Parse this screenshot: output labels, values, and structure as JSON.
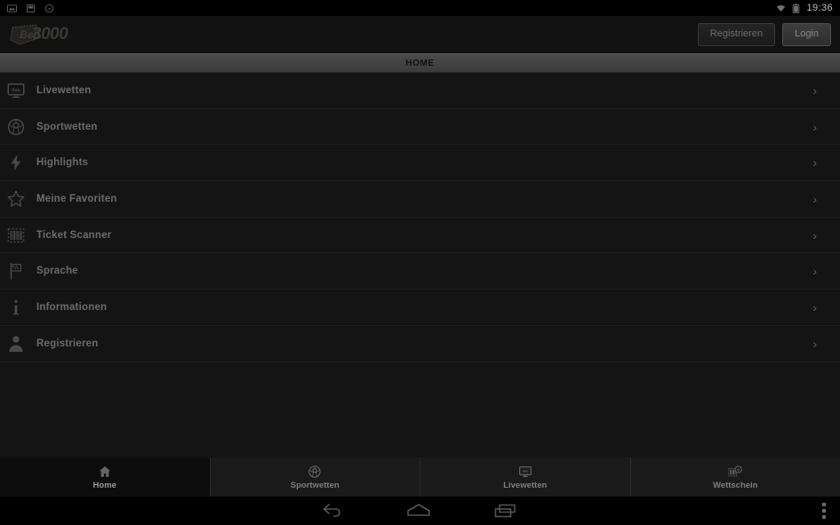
{
  "status_bar": {
    "icons": [
      "screenshot-icon",
      "sd-card-icon",
      "sync-icon"
    ],
    "wifi_icon": "wifi-icon",
    "battery_icon": "battery-icon",
    "time": "19:36"
  },
  "header": {
    "logo_text": "3000",
    "logo_brand": "Bet3000",
    "register_label": "Registrieren",
    "login_label": "Login"
  },
  "title_bar": {
    "title": "HOME"
  },
  "menu": {
    "items": [
      {
        "label": "Livewetten",
        "icon": "tv-monitor-icon",
        "chevron": "›"
      },
      {
        "label": "Sportwetten",
        "icon": "soccer-ball-icon",
        "chevron": "›"
      },
      {
        "label": "Highlights",
        "icon": "lightning-icon",
        "chevron": "›"
      },
      {
        "label": "Meine Favoriten",
        "icon": "star-icon",
        "chevron": "›"
      },
      {
        "label": "Ticket Scanner",
        "icon": "barcode-icon",
        "chevron": "›"
      },
      {
        "label": "Sprache",
        "icon": "flag-icon",
        "chevron": "›"
      },
      {
        "label": "Informationen",
        "icon": "info-icon",
        "chevron": "›"
      },
      {
        "label": "Registrieren",
        "icon": "person-icon",
        "chevron": "›"
      }
    ]
  },
  "bottom_tabs": {
    "items": [
      {
        "label": "Home",
        "icon": "home-icon",
        "active": true
      },
      {
        "label": "Sportwetten",
        "icon": "soccer-ball-icon",
        "active": false
      },
      {
        "label": "Livewetten",
        "icon": "tv-monitor-icon",
        "active": false
      },
      {
        "label": "Wettschein",
        "icon": "bet-slip-icon",
        "active": false
      }
    ]
  },
  "nav_bar": {
    "back_icon": "back-arrow-icon",
    "home_icon": "home-pentagon-icon",
    "recents_icon": "recent-apps-icon",
    "more_icon": "overflow-menu-icon"
  },
  "colors": {
    "background": "#141414",
    "header": "#111111",
    "title_bar": "#434343",
    "text_muted": "#6b6b6b",
    "divider": "#1f1f1f"
  }
}
